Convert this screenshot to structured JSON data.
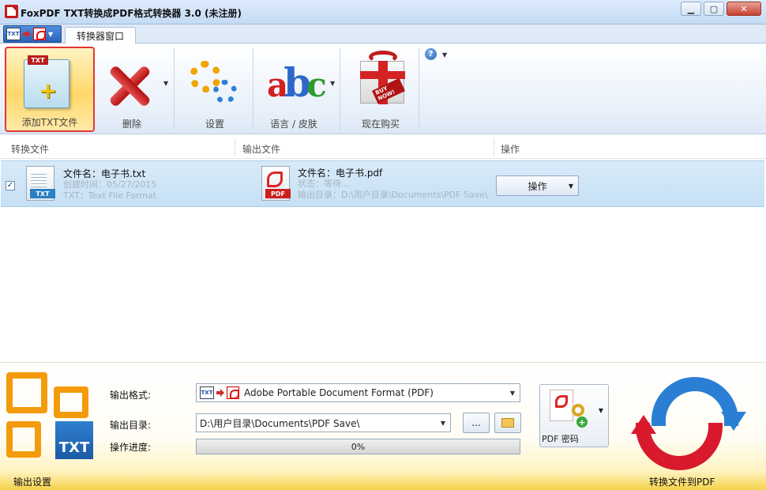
{
  "window": {
    "title": "FoxPDF TXT转换成PDF格式转换器 3.0 (未注册)",
    "controls": [
      "minimize",
      "maximize",
      "close"
    ]
  },
  "tabs": {
    "active_label": "转换器窗口"
  },
  "ribbon": {
    "add_txt": "添加TXT文件",
    "delete": "删除",
    "settings": "设置",
    "language_skin": "语言 / 皮肤",
    "buy_now": "现在购买",
    "txt_badge": "TXT",
    "gift_tag": "BUY NOW!"
  },
  "list": {
    "columns": [
      "转换文件",
      "输出文件",
      "操作"
    ],
    "rows": [
      {
        "checked": true,
        "source_name": "文件名：电子书.txt",
        "source_created": "创建时间：05/27/2015",
        "source_format": "TXT：Text File Format",
        "source_badge": "TXT",
        "output_name": "文件名：电子书.pdf",
        "output_status": "状态：等待...",
        "output_dir": "输出目录：D:\\用户目录\\Documents\\PDF Save\\",
        "output_badge": "PDF",
        "action_label": "操作"
      }
    ]
  },
  "output_settings": {
    "panel_label": "输出设置",
    "format_label": "输出格式:",
    "format_value": "Adobe Portable Document Format (PDF)",
    "dir_label": "输出目录:",
    "dir_value": "D:\\用户目录\\Documents\\PDF Save\\",
    "browse_label": "...",
    "progress_label": "操作进度:",
    "progress_value": "0%",
    "progress_fraction": 0,
    "pdf_password_label": "PDF 密码",
    "convert_label": "转换文件到PDF",
    "logo_text": "TXT"
  },
  "colors": {
    "title_bar": "#c4dbf4",
    "selected_row": "#c6e0f5",
    "accent_red": "#d81a2c",
    "accent_blue": "#2a7fd4",
    "bottom_gold": "#f5d34a"
  }
}
